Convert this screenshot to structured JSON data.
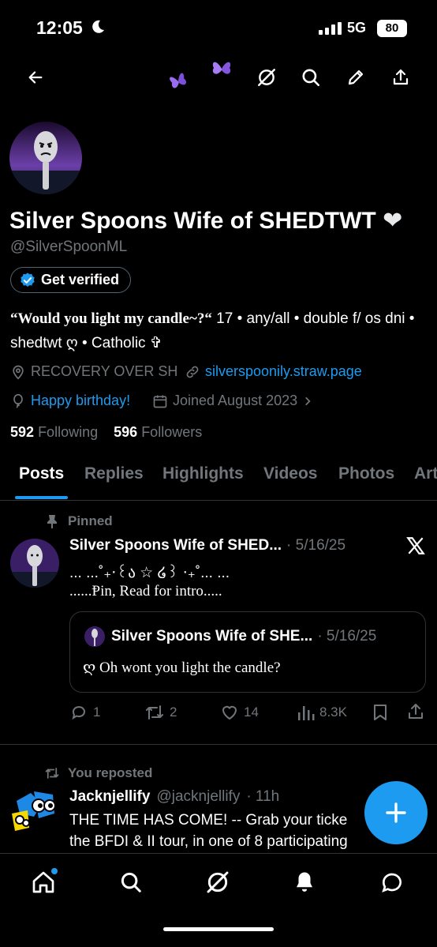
{
  "status_bar": {
    "time": "12:05",
    "network": "5G",
    "battery": "80"
  },
  "profile": {
    "display_name": "Silver Spoons Wife of SHEDTWT",
    "heart": "❤",
    "handle": "@SilverSpoonML",
    "get_verified_label": "Get verified",
    "bio_quote": "“Would you light my candle~?“",
    "bio_rest": " 17 • any/all • double f/ os dni • shedtwt ღ • Catholic ✞",
    "location": "RECOVERY OVER SH",
    "website": "silverspoonily.straw.page",
    "birthday": "Happy birthday!",
    "joined": "Joined August 2023",
    "following_count": "592",
    "following_label": "Following",
    "followers_count": "596",
    "followers_label": "Followers"
  },
  "tabs": [
    "Posts",
    "Replies",
    "Highlights",
    "Videos",
    "Photos",
    "Art"
  ],
  "pinned_post": {
    "pinned_label": "Pinned",
    "author": "Silver Spoons Wife of SHED...",
    "date": "· 5/16/25",
    "line1": "... ...˚₊‧꒰ა ☆ ໒꒱ ‧₊˚... ...",
    "line2": "......Ᵽin, Read for intro.....",
    "quote": {
      "author": "Silver Spoons Wife of SHE...",
      "date": "· 5/16/25",
      "text": "ღ Oh wont you light the candle?"
    },
    "replies": "1",
    "reposts": "2",
    "likes": "14",
    "views": "8.3K"
  },
  "repost": {
    "reposted_label": "You reposted",
    "author": "Jacknjellify",
    "handle": "@jacknjellify",
    "time": "· 11h",
    "line1": "THE TIME HAS COME! -- Grab your ticke",
    "line2": "the BFDI & II tour, in one of 8 participating"
  },
  "colors": {
    "accent": "#1d9bf0",
    "muted": "#71767b",
    "background": "#000000",
    "butterfly": "#9b6cf0"
  }
}
